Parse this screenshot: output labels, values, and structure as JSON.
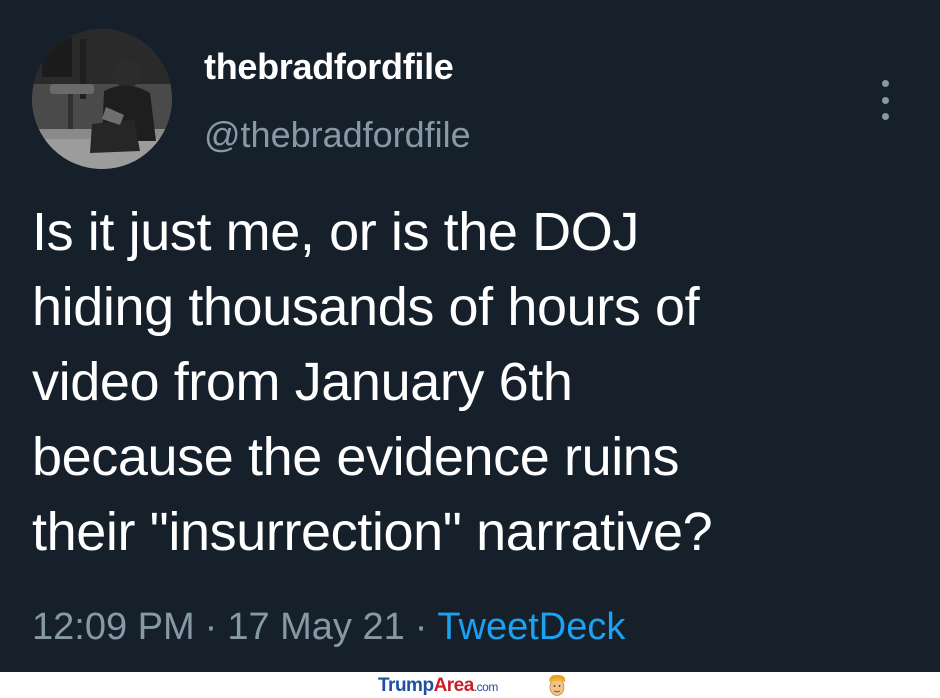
{
  "user": {
    "display_name": "thebradfordfile",
    "handle": "@thebradfordfile"
  },
  "tweet": {
    "lines": [
      "Is it just me, or is the DOJ",
      "hiding thousands of hours of",
      "video from January 6th",
      "because the evidence ruins",
      "their \"insurrection\" narrative?"
    ],
    "time": "12:09 PM",
    "date": "17 May 21",
    "separator": "·",
    "source": "TweetDeck"
  },
  "watermark": {
    "brand_part1": "Trump",
    "brand_part2": "Area",
    "suffix": ".com"
  },
  "icons": {
    "more": "vertical-ellipsis-icon",
    "avatar": "profile-photo",
    "logo": "trump-face-logo"
  },
  "colors": {
    "background": "#15202b",
    "primary_text": "#ffffff",
    "secondary_text": "#8899a6",
    "link": "#1da1f2",
    "watermark_blue": "#1f4fa3",
    "watermark_red": "#c8202a"
  }
}
